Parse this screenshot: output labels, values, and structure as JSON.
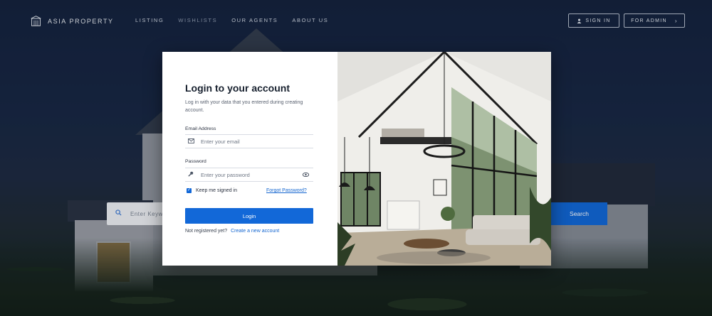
{
  "brand": {
    "name": "ASIA PROPERTY",
    "logo_icon": "building-icon"
  },
  "nav": {
    "items": [
      {
        "label": "LISTING"
      },
      {
        "label": "WISHLISTS"
      },
      {
        "label": "OUR AGENTS"
      },
      {
        "label": "ABOUT US"
      }
    ],
    "active_item": "WISHLISTS",
    "sign_in_label": "SIGN IN",
    "sign_in_icon": "user-icon",
    "admin_label": "FOR ADMIN",
    "admin_icon": "chevron-right-icon"
  },
  "hero_search": {
    "placeholder": "Enter Keyw",
    "button_label": "Search",
    "icon": "search-icon"
  },
  "login": {
    "title": "Login to your account",
    "subtitle": "Log in with your data that you entered during creating account.",
    "email_label": "Email Address",
    "email_placeholder": "Enter your email",
    "email_icon": "mail-icon",
    "password_label": "Password",
    "password_placeholder": "Enter your password",
    "password_icon": "key-icon",
    "show_password_icon": "eye-icon",
    "remember_label": "Keep me signed in",
    "remember_checked": true,
    "forgot_label": "Forgot Password?",
    "submit_label": "Login",
    "register_prompt": "Not registered yet?",
    "register_link": "Create a new account"
  },
  "colors": {
    "primary": "#1268d8",
    "link": "#1466d0",
    "title": "#17202e"
  }
}
